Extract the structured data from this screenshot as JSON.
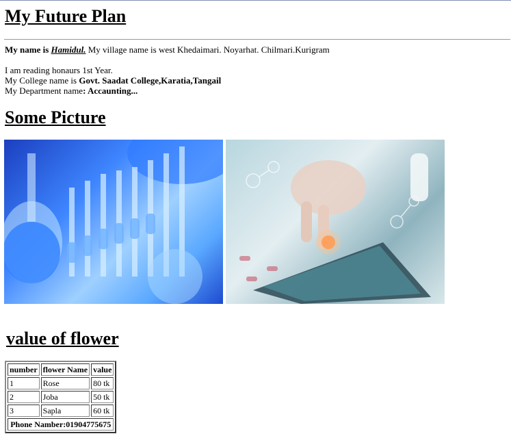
{
  "header": {
    "title": "My Future Plan"
  },
  "intro": {
    "name_label": "My name is",
    "name_value": "Hamidul.",
    "village_text": "My village name is west Khedaimari. Noyarhat. Chilmari.Kurigram",
    "reading_text": "I am reading honaurs 1st Year.",
    "college_label": "My College name is",
    "college_value": "Govt. Saadat College,Karatia,Tangail",
    "department_label": "My Department name",
    "department_value": ": Accaunting..."
  },
  "pictures": {
    "heading": "Some Picture",
    "items": [
      {
        "icon": "lab-glassware-photo"
      },
      {
        "icon": "medical-tablet-photo"
      }
    ]
  },
  "flowers": {
    "heading": "value of flower",
    "columns": [
      "number",
      "flower Name",
      "value"
    ],
    "rows": [
      [
        "1",
        "Rose",
        "80 tk"
      ],
      [
        "2",
        "Joba",
        "50 tk"
      ],
      [
        "3",
        "Sapla",
        "60 tk"
      ]
    ],
    "footer": "Phone Namber:01904775675"
  }
}
